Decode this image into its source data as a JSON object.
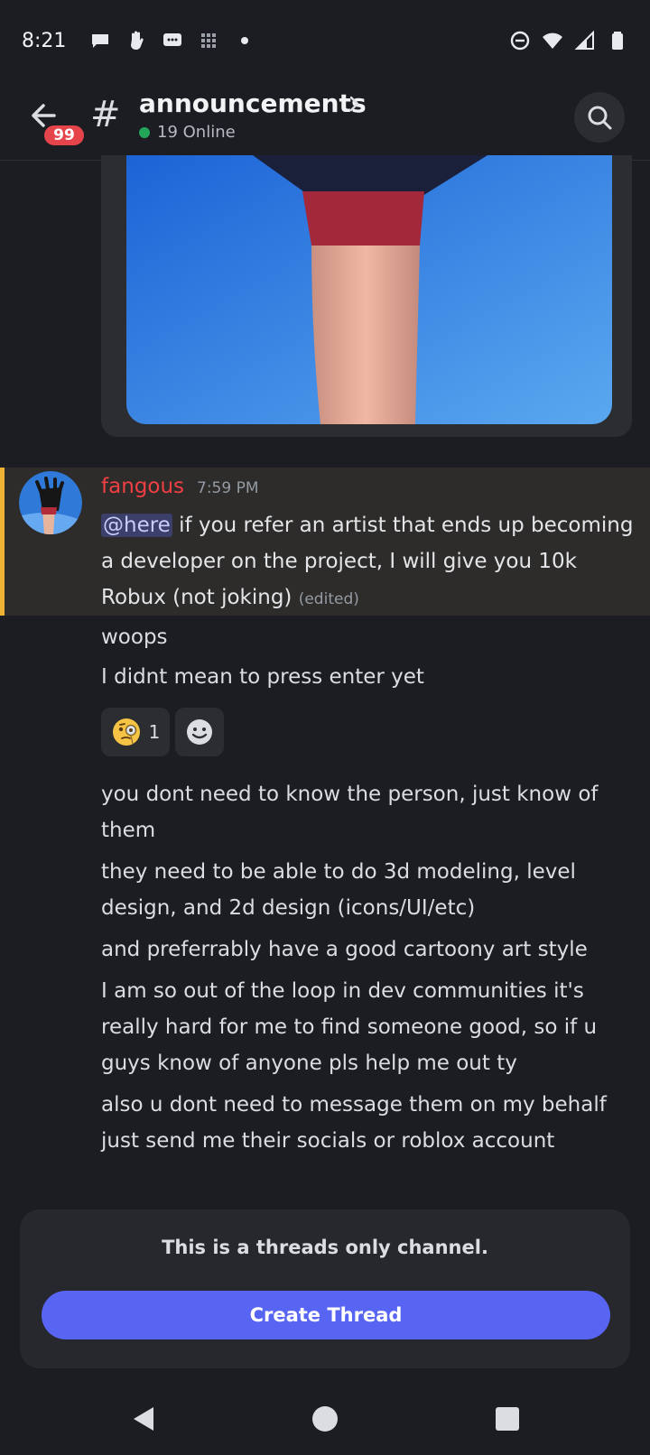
{
  "status": {
    "time": "8:21"
  },
  "header": {
    "badge": "99",
    "hash": "#",
    "channel_name": "announcements",
    "online": "19 Online"
  },
  "message": {
    "author": "fangous",
    "time": "7:59 PM",
    "mention": "@here",
    "text": " if you refer an artist that ends up becoming a developer on the project, I will give you 10k Robux (not joking)",
    "edited": "(edited)"
  },
  "followups": {
    "line1": "woops",
    "line2": "I didnt mean to press enter yet",
    "line3": "you dont need to know the person, just know of them",
    "line4": "they need to be able to do 3d modeling, level design, and 2d design (icons/UI/etc)",
    "line5": "and preferrably have a good cartoony art style",
    "line6": "I am so out of the loop in dev communities it's really hard for me to find someone good, so if u guys know of anyone pls help me out ty",
    "line7": "also u dont need to message them on my behalf just send me their socials or roblox account"
  },
  "reaction": {
    "emoji": "face-with-monocle",
    "count": "1"
  },
  "thread_panel": {
    "info": "This is a threads only channel.",
    "button": "Create Thread"
  },
  "colors": {
    "accent": "#5865f2",
    "author": "#f23f43",
    "highlight_border": "#f0b232",
    "online": "#23a55a",
    "badge": "#e5444a"
  }
}
